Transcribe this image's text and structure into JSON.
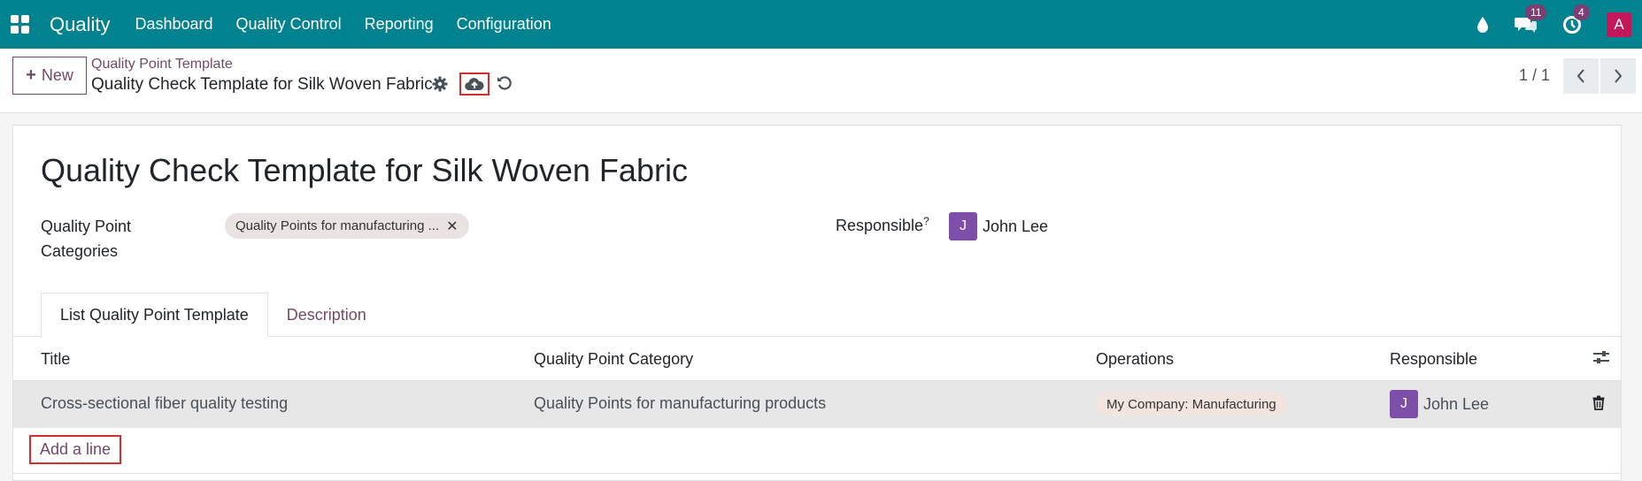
{
  "navbar": {
    "app_name": "Quality",
    "menu": [
      "Dashboard",
      "Quality Control",
      "Reporting",
      "Configuration"
    ],
    "messages_badge": "11",
    "activities_badge": "4",
    "user_initial": "A",
    "bg_color": "#00838f"
  },
  "control": {
    "new_label": "New",
    "breadcrumb": "Quality Point Template",
    "record_title": "Quality Check Template for Silk Woven Fabric",
    "pager": "1 / 1"
  },
  "form": {
    "title": "Quality Check Template for Silk Woven Fabric",
    "categories_label": "Quality Point Categories",
    "category_tag": "Quality Points for manufacturing ...",
    "responsible_label": "Responsible",
    "responsible_help": "?",
    "responsible_initial": "J",
    "responsible_name": "John Lee"
  },
  "tabs": [
    {
      "label": "List Quality Point Template",
      "active": true
    },
    {
      "label": "Description",
      "active": false
    }
  ],
  "table": {
    "headers": [
      "Title",
      "Quality Point Category",
      "Operations",
      "Responsible"
    ],
    "rows": [
      {
        "title": "Cross-sectional fiber quality testing",
        "category": "Quality Points for manufacturing products",
        "operation": "My Company: Manufacturing",
        "responsible_initial": "J",
        "responsible": "John Lee"
      }
    ],
    "add_line": "Add a line"
  }
}
